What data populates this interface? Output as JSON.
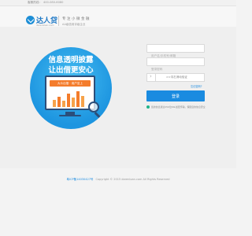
{
  "topbar": {
    "hotline_label": "客服热线：",
    "hotline_number": "400-080-6080"
  },
  "logo": {
    "name": "达人贷",
    "sub": "darenloan.com"
  },
  "header": {
    "slogan_line1": "专注小微金融",
    "slogan_line2": "AA级信用评级企业"
  },
  "promo": {
    "line1": "信息透明披露",
    "line2": "让出借更安心",
    "banner": "大众出借 · 用户至上"
  },
  "login": {
    "username_placeholder": "用户名/手机号/邮箱",
    "password_placeholder": "登录密码",
    "slider_text": ">>向右滑动验证",
    "forgot_label": "忘记密码?",
    "login_button": "登录",
    "security_tip": "您的信息通过256位SSL加密传输，保障您的信息安全"
  },
  "footer": {
    "icp": "粤ICP备14030427号",
    "copyright": "Copyright © 2015 darenloan.com All Rights Reserved"
  },
  "colors": {
    "brand_blue": "#1a8be0",
    "banner_orange": "#f47c2c",
    "monitor_navy": "#2b4e7a",
    "safe_green": "#1fb38a"
  }
}
